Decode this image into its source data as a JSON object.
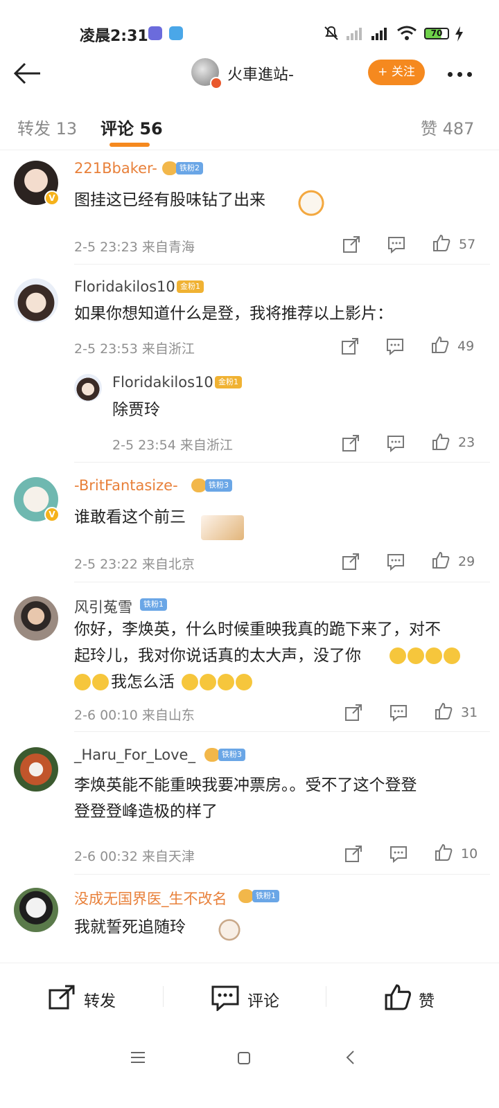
{
  "status_bar": {
    "time": "凌晨2:31",
    "battery": "70"
  },
  "header": {
    "title": "火車進站-",
    "follow_label": "+ 关注"
  },
  "tabs": [
    {
      "label": "转发 13"
    },
    {
      "label": "评论 56"
    },
    {
      "label": "赞 487"
    }
  ],
  "comments": [
    {
      "user": "221Bbaker-",
      "badge": "铁粉2",
      "text": "图挂这已经有股味钻了出来",
      "meta": "2-5 23:23  来自青海",
      "likes": "57"
    },
    {
      "user": "Floridakilos10",
      "badge": "金粉1",
      "text": "如果你想知道什么是登，我将推荐以上影片：",
      "meta": "2-5 23:53  来自浙江",
      "likes": "49",
      "reply": {
        "user": "Floridakilos10",
        "badge": "金粉1",
        "text": "除贾玲",
        "meta": "2-5 23:54  来自浙江",
        "likes": "23"
      }
    },
    {
      "user": "-BritFantasize-",
      "badge": "铁粉3",
      "text": "谁敢看这个前三",
      "meta": "2-5 23:22  来自北京",
      "likes": "29"
    },
    {
      "user": "风引菟雪",
      "badge": "铁粉1",
      "text_line1": "你好，李焕英，什么时候重映我真的跪下来了，对不",
      "text_line2": "起玲儿，我对你说话真的太大声，没了你",
      "text_line3": "我怎么活",
      "meta": "2-6 00:10  来自山东",
      "likes": "31"
    },
    {
      "user": "_Haru_For_Love_",
      "badge": "铁粉3",
      "text_line1": "李焕英能不能重映我要冲票房。。受不了这个登登",
      "text_line2": "登登登峰造极的样了",
      "meta": "2-6 00:32  来自天津",
      "likes": "10"
    },
    {
      "user": "没成无国界医_生不改名",
      "badge": "铁粉1",
      "text": "我就誓死追随玲"
    }
  ],
  "bottom_bar": {
    "repost": "转发",
    "comment": "评论",
    "like": "赞"
  },
  "colors": {
    "accent": "#f5891f",
    "username_orange": "#e8803a",
    "meta_gray": "#909090"
  },
  "icons": [
    "back-arrow-icon",
    "more-icon",
    "share-icon",
    "comment-icon",
    "thumbs-up-icon",
    "crying-emoji-icon"
  ]
}
